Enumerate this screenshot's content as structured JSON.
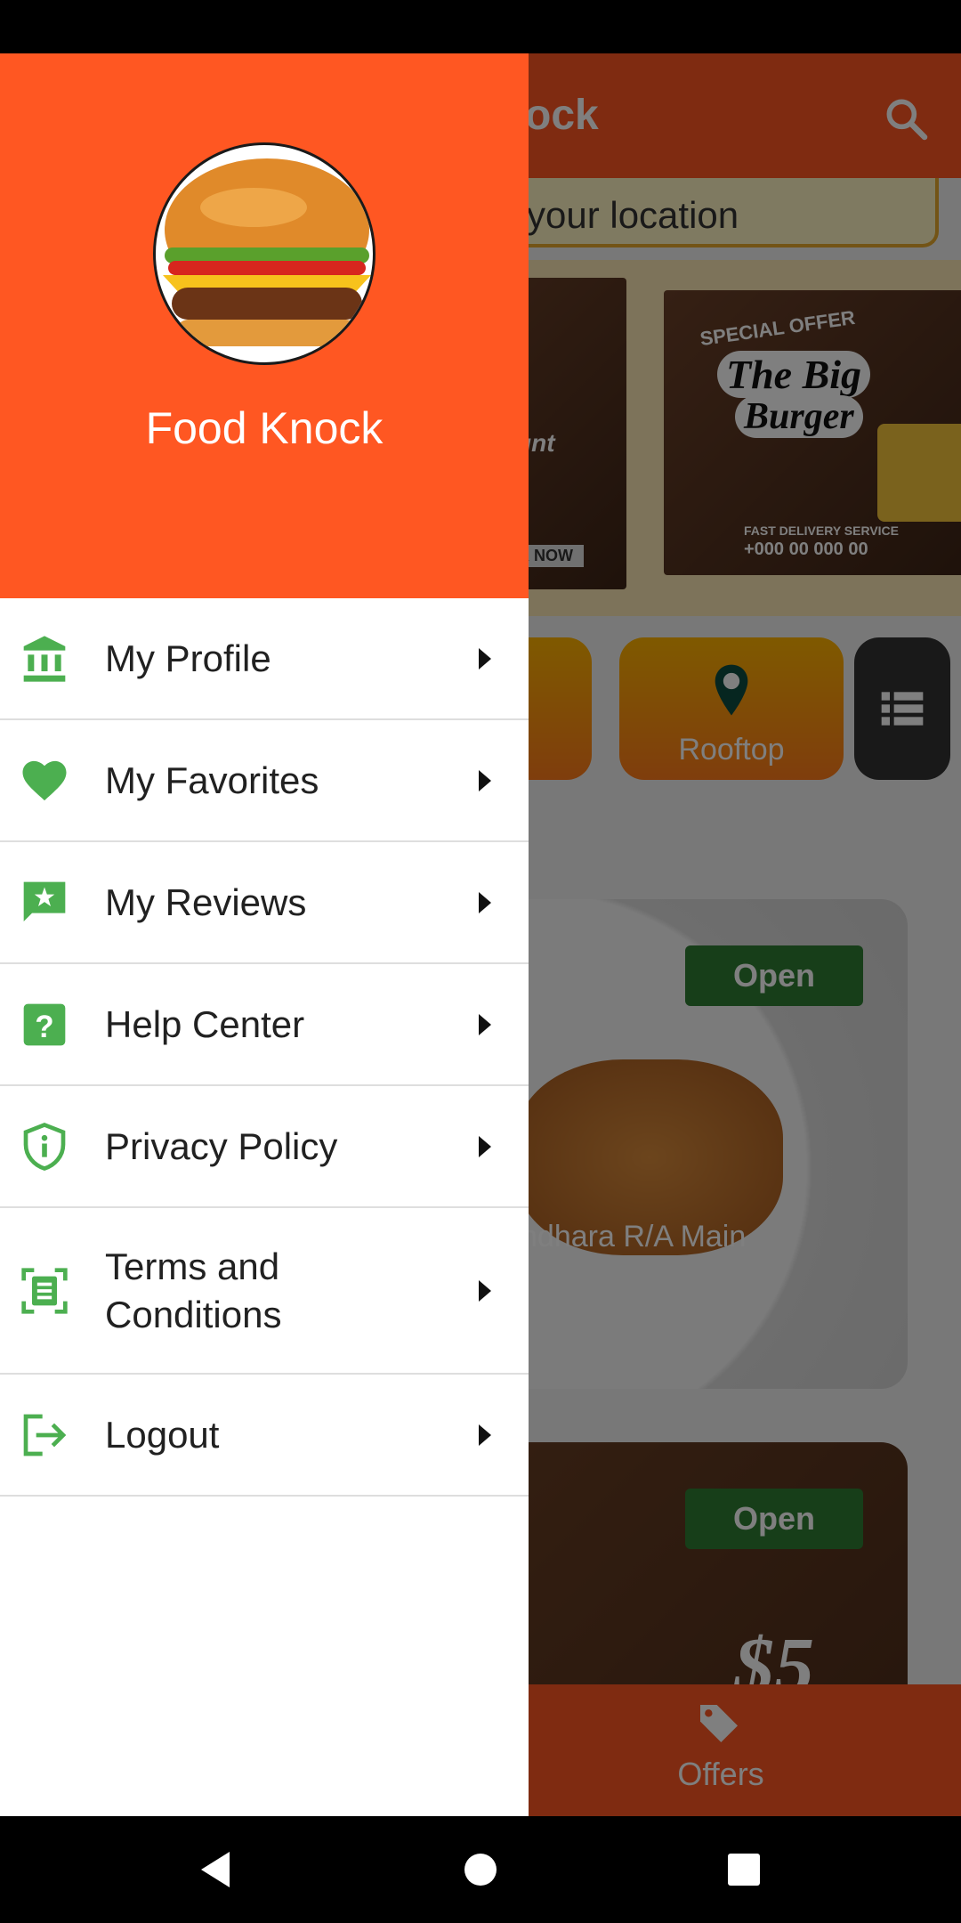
{
  "app": {
    "title_partial": "ock",
    "location_partial": "your location",
    "banner_left_text": "unt",
    "banner_left_cta": "R NOW",
    "banner_right": {
      "tag": "SPECIAL OFFER",
      "headline_1": "The Big",
      "headline_2": "Burger",
      "delivery": "FAST DELIVERY SERVICE",
      "phone": "+000 00 000 00"
    },
    "category": "Rooftop",
    "card1": {
      "status": "Open",
      "address_partial": "ndhara R/A Main"
    },
    "card2": {
      "status": "Open",
      "price": "$5"
    },
    "bottom_tab": "Offers"
  },
  "drawer": {
    "brand_name": "Food Knock",
    "menu": [
      {
        "label": "My Profile",
        "icon": "bank-icon"
      },
      {
        "label": "My Favorites",
        "icon": "heart-icon"
      },
      {
        "label": "My Reviews",
        "icon": "review-icon"
      },
      {
        "label": "Help Center",
        "icon": "help-icon"
      },
      {
        "label": "Privacy Policy",
        "icon": "shield-icon"
      },
      {
        "label": "Terms and Conditions",
        "icon": "document-icon"
      },
      {
        "label": "Logout",
        "icon": "logout-icon"
      }
    ]
  },
  "colors": {
    "primary": "#ff5722",
    "accent_green": "#4caf50",
    "badge_green": "#2e7d32"
  }
}
